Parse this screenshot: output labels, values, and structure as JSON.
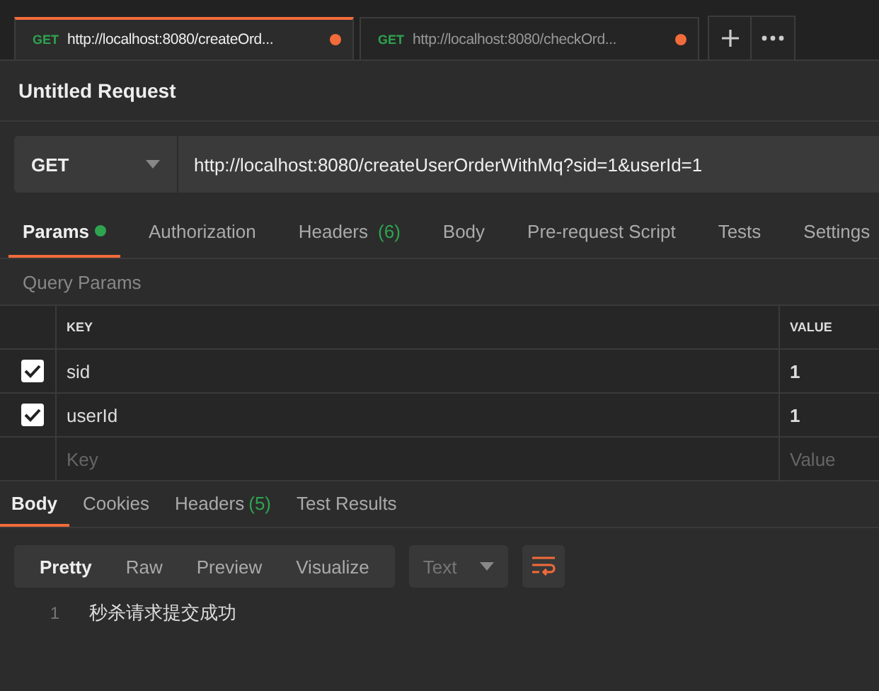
{
  "tabs": [
    {
      "method": "GET",
      "url": "http://localhost:8080/createOrd...",
      "unsaved": true,
      "selected": true
    },
    {
      "method": "GET",
      "url": "http://localhost:8080/checkOrd...",
      "unsaved": true,
      "selected": false
    }
  ],
  "request": {
    "title": "Untitled Request",
    "method": "GET",
    "url": "http://localhost:8080/createUserOrderWithMq?sid=1&userId=1"
  },
  "request_tabs": [
    {
      "label": "Params",
      "has_values": true,
      "selected": true
    },
    {
      "label": "Authorization",
      "has_values": false,
      "selected": false
    },
    {
      "label": "Headers",
      "count": "(6)",
      "has_values": false,
      "selected": false
    },
    {
      "label": "Body",
      "has_values": false,
      "selected": false
    },
    {
      "label": "Pre-request Script",
      "has_values": false,
      "selected": false
    },
    {
      "label": "Tests",
      "has_values": false,
      "selected": false
    },
    {
      "label": "Settings",
      "has_values": false,
      "selected": false
    }
  ],
  "params": {
    "label": "Query Params",
    "columns": [
      "KEY",
      "VALUE"
    ],
    "rows": [
      {
        "key": "sid",
        "value": "1",
        "checked": true
      },
      {
        "key": "userId",
        "value": "1",
        "checked": true
      }
    ],
    "new_row": {
      "key_placeholder": "Key",
      "value_placeholder": "Value"
    }
  },
  "response_tabs": [
    {
      "label": "Body",
      "selected": true
    },
    {
      "label": "Cookies",
      "selected": false
    },
    {
      "label": "Headers",
      "count": "(5)",
      "selected": false
    },
    {
      "label": "Test Results",
      "selected": false
    }
  ],
  "view_modes": [
    {
      "label": "Pretty",
      "selected": true
    },
    {
      "label": "Raw",
      "selected": false
    },
    {
      "label": "Preview",
      "selected": false
    },
    {
      "label": "Visualize",
      "selected": false
    }
  ],
  "format": "Text",
  "response_lines": [
    {
      "number": "1",
      "text": "秒杀请求提交成功"
    }
  ]
}
